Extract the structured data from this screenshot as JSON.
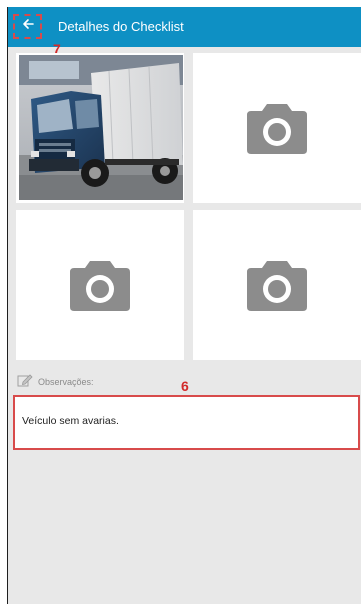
{
  "appbar": {
    "title": "Detalhes do Checklist",
    "back_icon": "arrow-left-icon",
    "color": "#0e90c4"
  },
  "markers": {
    "back": "7",
    "observations": "6"
  },
  "photos": [
    {
      "state": "filled",
      "subject": "truck-photo"
    },
    {
      "state": "empty",
      "icon": "camera-icon"
    },
    {
      "state": "empty",
      "icon": "camera-icon"
    },
    {
      "state": "empty",
      "icon": "camera-icon"
    }
  ],
  "observations": {
    "label": "Observações:",
    "icon": "pencil-note-icon",
    "value": "Veículo sem avarias."
  },
  "colors": {
    "annotation_red": "#d84b4b",
    "background": "#e8e8e8",
    "camera_gray": "#8c8c8c"
  }
}
